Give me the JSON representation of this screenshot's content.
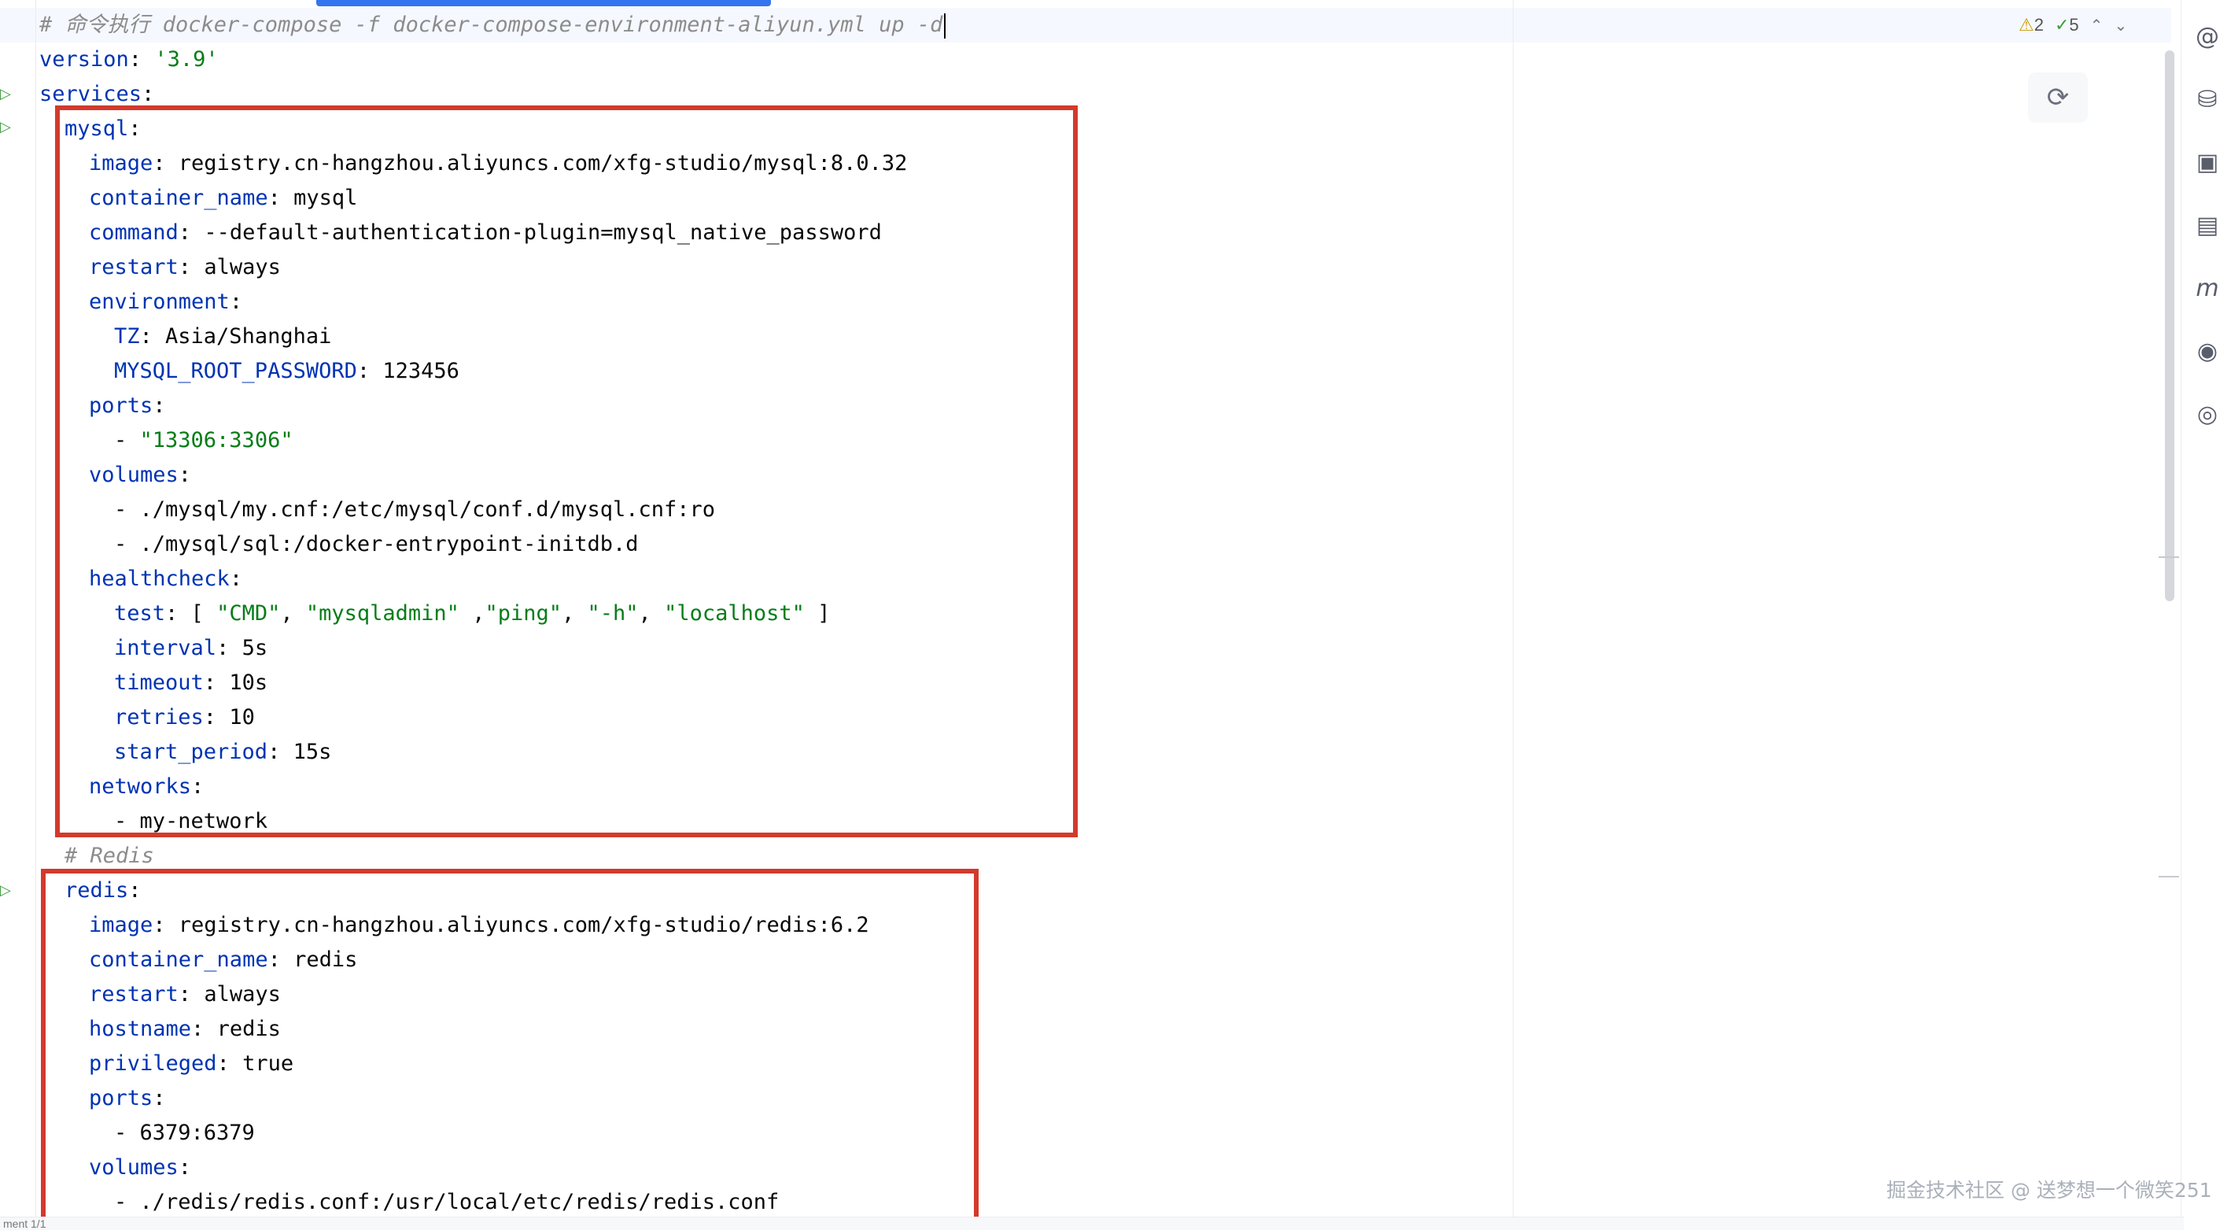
{
  "editor": {
    "comment_line": "# 命令执行 docker-compose -f docker-compose-environment-aliyun.yml up -d",
    "version_key": "version",
    "version_value": "'3.9'",
    "services_key": "services",
    "mysql": {
      "name": "mysql",
      "image_key": "image",
      "image_value": "registry.cn-hangzhou.aliyuncs.com/xfg-studio/mysql:8.0.32",
      "container_name_key": "container_name",
      "container_name_value": "mysql",
      "command_key": "command",
      "command_value": "--default-authentication-plugin=mysql_native_password",
      "restart_key": "restart",
      "restart_value": "always",
      "environment_key": "environment",
      "tz_key": "TZ",
      "tz_value": "Asia/Shanghai",
      "root_pw_key": "MYSQL_ROOT_PASSWORD",
      "root_pw_value": "123456",
      "ports_key": "ports",
      "port_value": "\"13306:3306\"",
      "volumes_key": "volumes",
      "volume_1": "./mysql/my.cnf:/etc/mysql/conf.d/mysql.cnf:ro",
      "volume_2": "./mysql/sql:/docker-entrypoint-initdb.d",
      "healthcheck_key": "healthcheck",
      "test_key": "test",
      "test_cmd": "\"CMD\"",
      "test_mysqladmin": "\"mysqladmin\"",
      "test_ping": "\"ping\"",
      "test_h": "\"-h\"",
      "test_localhost": "\"localhost\"",
      "interval_key": "interval",
      "interval_value": "5s",
      "timeout_key": "timeout",
      "timeout_value": "10s",
      "retries_key": "retries",
      "retries_value": "10",
      "start_period_key": "start_period",
      "start_period_value": "15s",
      "networks_key": "networks",
      "network_value": "my-network"
    },
    "redis_comment": "# Redis",
    "redis": {
      "name": "redis",
      "image_key": "image",
      "image_value": "registry.cn-hangzhou.aliyuncs.com/xfg-studio/redis:6.2",
      "container_name_key": "container_name",
      "container_name_value": "redis",
      "restart_key": "restart",
      "restart_value": "always",
      "hostname_key": "hostname",
      "hostname_value": "redis",
      "privileged_key": "privileged",
      "privileged_value": "true",
      "ports_key": "ports",
      "port_value": "6379:6379",
      "volumes_key": "volumes",
      "volume_1": "./redis/redis.conf:/usr/local/etc/redis/redis.conf"
    }
  },
  "inspection": {
    "warnings": "2",
    "weak_warnings": "5",
    "warning_icon": "warning-triangle-icon",
    "check_icon": "check-icon"
  },
  "watermark": "掘金技术社区 @ 送梦想一个微笑251",
  "status_text": "ment 1/1",
  "colors": {
    "keyword": "#0033b3",
    "string": "#067d17",
    "comment": "#8c8c8c",
    "highlight_box": "#d23a2c",
    "caret_row": "#f5f8fe"
  }
}
